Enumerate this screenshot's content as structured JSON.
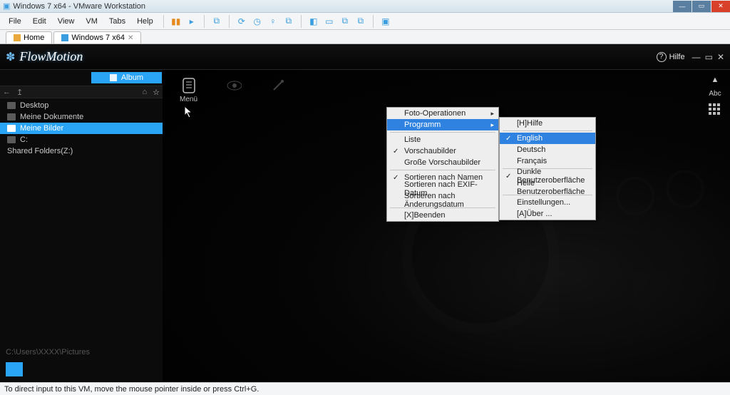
{
  "vmware": {
    "title": "Windows 7 x64 - VMware Workstation",
    "menu": [
      "File",
      "Edit",
      "View",
      "VM",
      "Tabs",
      "Help"
    ],
    "tabs": [
      {
        "label": "Home",
        "icon": "home-icon",
        "close": false
      },
      {
        "label": "Windows 7 x64",
        "icon": "monitor-icon",
        "close": true
      }
    ],
    "status": "To direct input to this VM, move the mouse pointer inside or press Ctrl+G."
  },
  "flowmotion": {
    "app_name": "FlowMotion",
    "help_label": "Hilfe",
    "album_label": "Album",
    "tree": [
      {
        "label": "Desktop",
        "selected": false,
        "level": 1
      },
      {
        "label": "Meine Dokumente",
        "selected": false,
        "level": 1
      },
      {
        "label": "Meine Bilder",
        "selected": true,
        "level": 2
      },
      {
        "label": "C:",
        "selected": false,
        "level": 1
      },
      {
        "label": "Shared Folders(Z:)",
        "selected": false,
        "level": 1
      }
    ],
    "path": "C:\\Users\\XXXX\\Pictures",
    "toolbar": {
      "menu": "Menü"
    },
    "right_tool_label": "Abc"
  },
  "menu1": {
    "items": [
      {
        "label": "Foto-Operationen",
        "sub": true,
        "hl": false,
        "sep_after": false
      },
      {
        "label": "Programm",
        "sub": true,
        "hl": true,
        "sep_after": true
      },
      {
        "label": "Liste",
        "check": false,
        "sep_after": false
      },
      {
        "label": "Vorschaubilder",
        "check": true,
        "sep_after": false
      },
      {
        "label": "Große Vorschaubilder",
        "check": false,
        "sep_after": true
      },
      {
        "label": "Sortieren nach Namen",
        "check": true,
        "sep_after": false
      },
      {
        "label": "Sortieren nach EXIF-Datum",
        "check": false,
        "sep_after": false
      },
      {
        "label": "Sortieren nach Änderungsdatum",
        "check": false,
        "sep_after": true
      },
      {
        "label": "[X]Beenden",
        "check": false,
        "sep_after": false
      }
    ]
  },
  "menu2": {
    "items": [
      {
        "label": "[H]Hilfe",
        "sep_after": true
      },
      {
        "label": "English",
        "check": true,
        "hl": true
      },
      {
        "label": "Deutsch"
      },
      {
        "label": "Français",
        "sep_after": true
      },
      {
        "label": "Dunkle Benutzeroberfläche",
        "check": true
      },
      {
        "label": "Helle Benutzeroberfläche",
        "sep_after": true
      },
      {
        "label": "Einstellungen..."
      },
      {
        "label": "[A]Über ..."
      }
    ]
  }
}
